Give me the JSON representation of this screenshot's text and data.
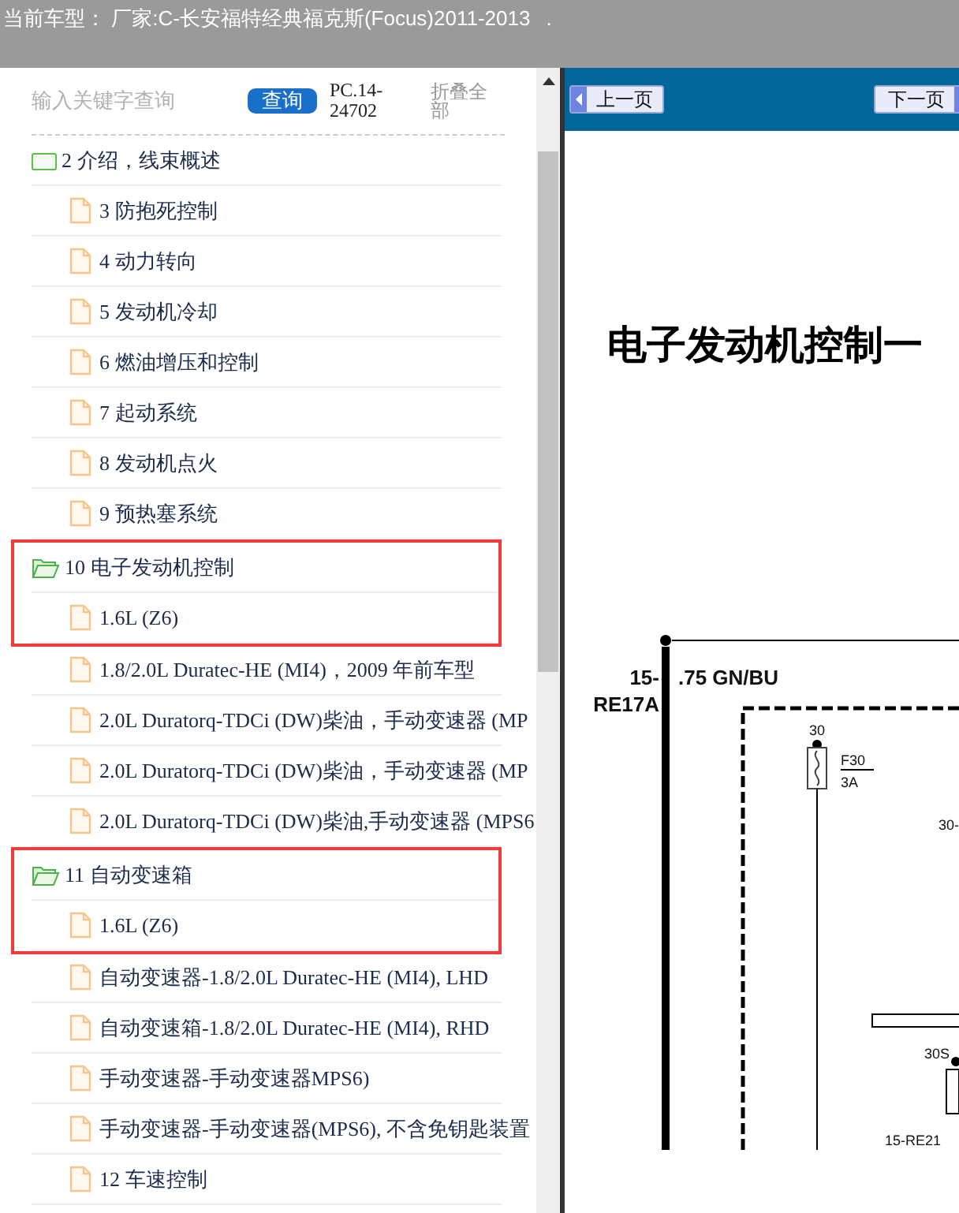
{
  "top_bar": {
    "title": "当前车型： 厂家:C-长安福特经典福克斯(Focus)2011-2013",
    "marker": "."
  },
  "search": {
    "placeholder": "输入关键字查询",
    "button": "查询",
    "code": "PC.14-24702",
    "collapse_all": "折叠全部"
  },
  "tree": [
    {
      "kind": "folder",
      "label": "2 介绍，线束概述",
      "expanded": false,
      "highlighted": false
    },
    {
      "kind": "doc",
      "label": "3 防抱死控制",
      "highlighted": false
    },
    {
      "kind": "doc",
      "label": "4 动力转向",
      "highlighted": false
    },
    {
      "kind": "doc",
      "label": "5 发动机冷却",
      "highlighted": false
    },
    {
      "kind": "doc",
      "label": "6 燃油增压和控制",
      "highlighted": false
    },
    {
      "kind": "doc",
      "label": "7 起动系统",
      "highlighted": false
    },
    {
      "kind": "doc",
      "label": "8 发动机点火",
      "highlighted": false
    },
    {
      "kind": "doc",
      "label": "9 预热塞系统",
      "highlighted": false
    },
    {
      "kind": "folder",
      "label": "10 电子发动机控制",
      "expanded": true,
      "highlighted": true,
      "children": [
        {
          "kind": "doc",
          "label": "1.6L (Z6)",
          "highlighted": true
        },
        {
          "kind": "doc",
          "label": "1.8/2.0L Duratec-HE (MI4)，2009 年前车型",
          "highlighted": false
        },
        {
          "kind": "doc",
          "label": "2.0L Duratorq-TDCi (DW)柴油，手动变速器 (MP",
          "highlighted": false
        },
        {
          "kind": "doc",
          "label": "2.0L Duratorq-TDCi (DW)柴油，手动变速器 (MP",
          "highlighted": false
        },
        {
          "kind": "doc",
          "label": "2.0L Duratorq-TDCi (DW)柴油,手动变速器 (MPS6",
          "highlighted": false
        }
      ]
    },
    {
      "kind": "folder",
      "label": "11 自动变速箱",
      "expanded": true,
      "highlighted": true,
      "children": [
        {
          "kind": "doc",
          "label": "1.6L (Z6)",
          "highlighted": true
        },
        {
          "kind": "doc",
          "label": "自动变速器-1.8/2.0L Duratec-HE (MI4), LHD",
          "highlighted": false
        },
        {
          "kind": "doc",
          "label": "自动变速箱-1.8/2.0L Duratec-HE (MI4), RHD",
          "highlighted": false
        },
        {
          "kind": "doc",
          "label": "手动变速器-手动变速器MPS6)",
          "highlighted": false
        },
        {
          "kind": "doc",
          "label": "手动变速器-手动变速器(MPS6), 不含免钥匙装置",
          "highlighted": false
        }
      ]
    },
    {
      "kind": "doc",
      "label": "12 车速控制",
      "highlighted": false
    }
  ],
  "viewer": {
    "prev": "上一页",
    "next": "下一页",
    "title": "电子发动机控制一",
    "diagram_labels": [
      "15-",
      "RE17A",
      ".75 GN/BU",
      "30",
      "F30",
      "3A",
      "30-",
      "30S",
      "15-RE21"
    ]
  }
}
